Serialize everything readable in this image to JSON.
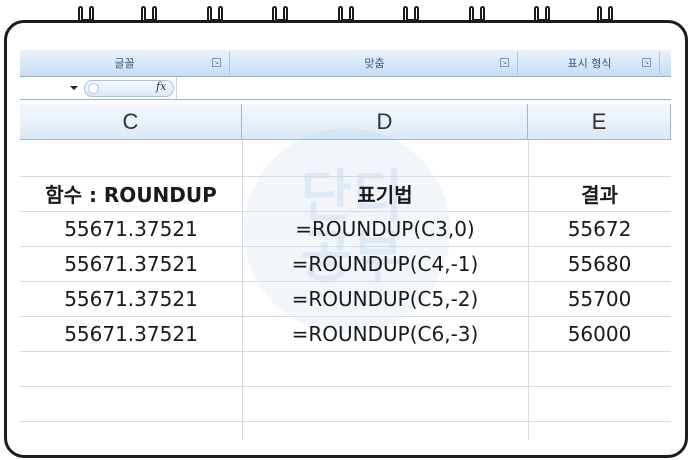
{
  "ribbon": {
    "groups": [
      {
        "label": "글꼴"
      },
      {
        "label": "맞춤"
      },
      {
        "label": "표시 형식"
      }
    ]
  },
  "formula_bar": {
    "fx_label": "fx",
    "formula": ""
  },
  "columns": [
    "C",
    "D",
    "E"
  ],
  "table": {
    "header": [
      "함수 : ROUNDUP",
      "표기법",
      "결과"
    ],
    "rows": [
      [
        "55671.37521",
        "=ROUNDUP(C3,0)",
        "55672"
      ],
      [
        "55671.37521",
        "=ROUNDUP(C4,-1)",
        "55680"
      ],
      [
        "55671.37521",
        "=ROUNDUP(C5,-2)",
        "55700"
      ],
      [
        "55671.37521",
        "=ROUNDUP(C6,-3)",
        "56000"
      ]
    ]
  },
  "watermark": {
    "text": "단디 공부"
  },
  "colors": {
    "ribbon": "#c9dcf2",
    "frame": "#1c1c1c",
    "gridline": "#d4dbe3"
  }
}
